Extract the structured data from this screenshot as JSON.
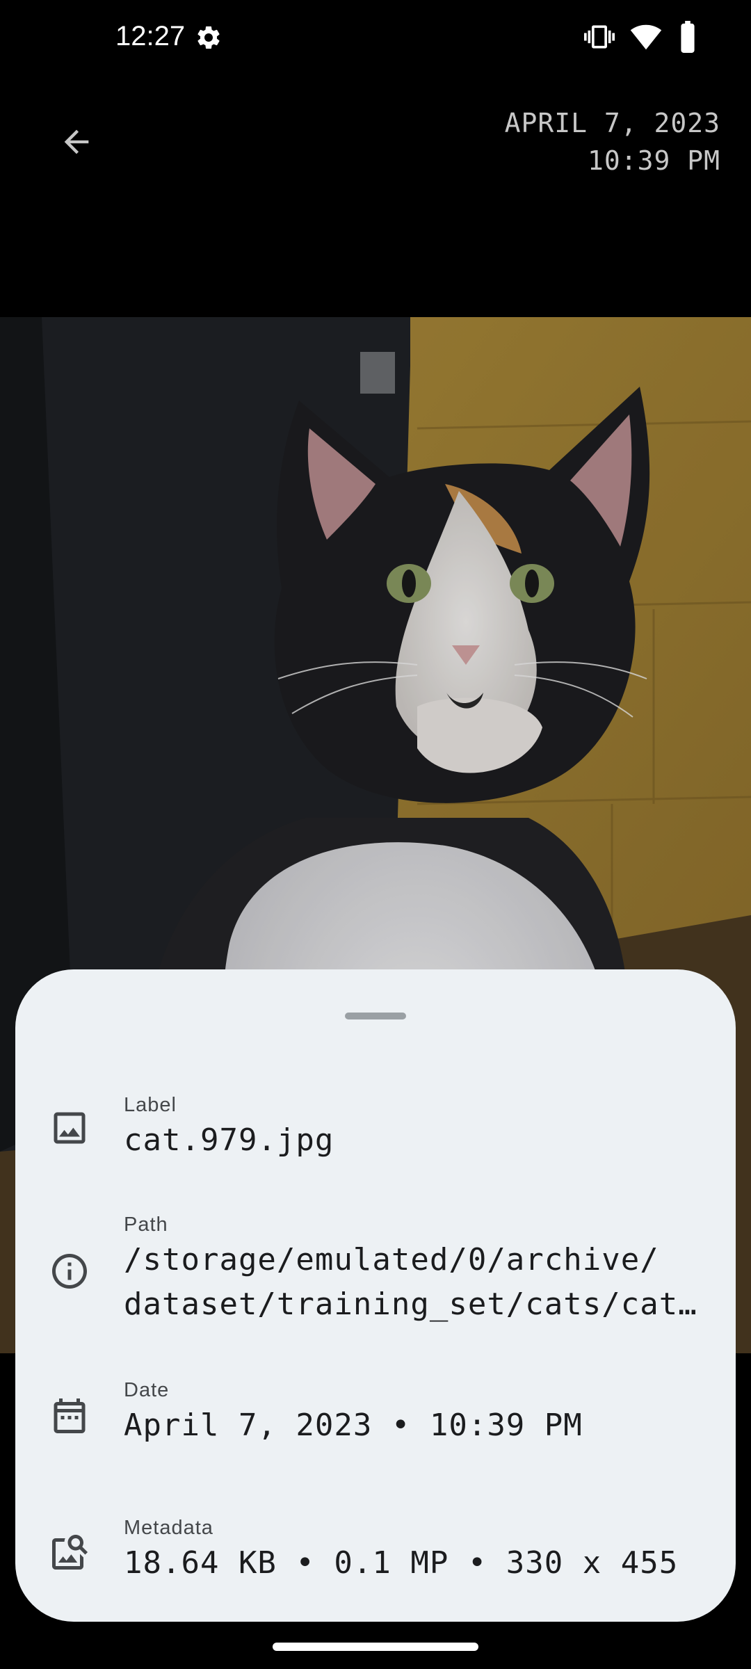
{
  "status_bar": {
    "time": "12:27",
    "icons": [
      "gear-icon",
      "vibrate-icon",
      "wifi-icon",
      "battery-icon"
    ]
  },
  "header": {
    "back_icon": "arrow-back-icon",
    "date_line1": "APRIL 7, 2023",
    "date_line2": "10:39 PM"
  },
  "photo": {
    "subject": "cat"
  },
  "details": {
    "label": {
      "title": "Label",
      "value": "cat.979.jpg",
      "icon": "image-icon"
    },
    "path": {
      "title": "Path",
      "value_line1": "/storage/emulated/0/archive/",
      "value_line2": "dataset/training_set/cats/cat…",
      "icon": "info-icon"
    },
    "date": {
      "title": "Date",
      "value": "April 7, 2023 • 10:39 PM",
      "icon": "calendar-icon"
    },
    "metadata": {
      "title": "Metadata",
      "value": "18.64 KB • 0.1 MP • 330 x 455",
      "icon": "image-search-icon"
    }
  },
  "colors": {
    "sheet_background": "#edf1f4",
    "icon_color": "#44474a",
    "header_text": "#c7c7c7"
  }
}
